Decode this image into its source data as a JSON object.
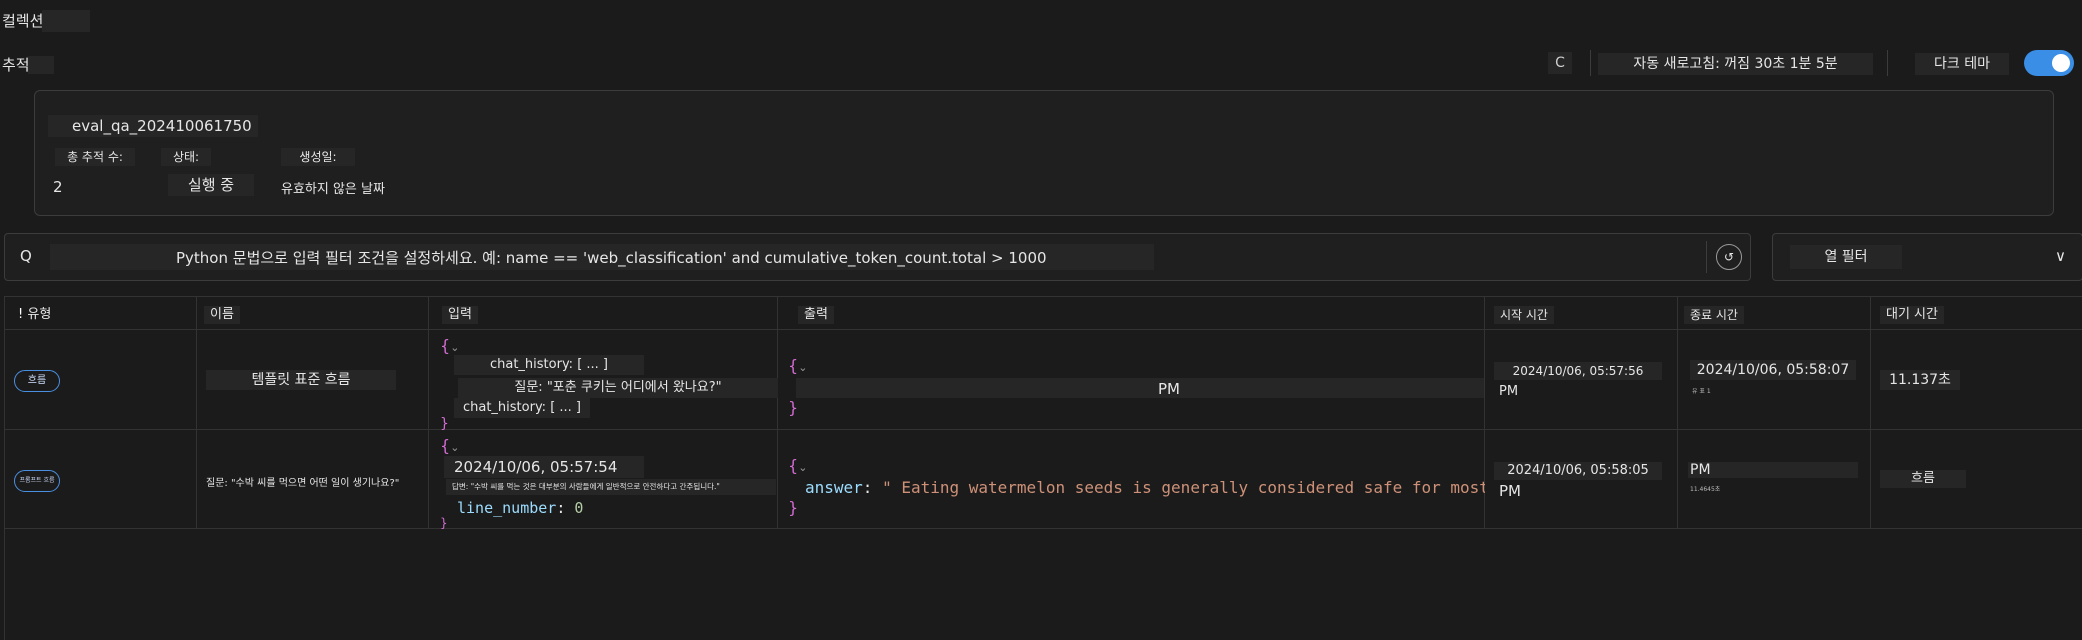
{
  "header": {
    "title": "컬렉션",
    "subnav": "추적"
  },
  "toolbar": {
    "refresh_label": "C",
    "auto_refresh": "자동 새로고침: 꺼짐 30초 1분 5분",
    "dark_mode_label": "다크 테마",
    "dark_mode_on": true
  },
  "run": {
    "name": "eval_qa_202410061750",
    "count_label": "총 추적 수:",
    "count_value": "2",
    "status_label": "상태:",
    "status_value": "실행 중",
    "created_label": "생성일:",
    "created_value": "유효하지 않은 날짜"
  },
  "search": {
    "icon": "Q",
    "placeholder": "Python 문법으로 입력 필터 조건을 설정하세요. 예: name == 'web_classification' and cumulative_token_count.total > 1000",
    "action_icon": "refresh-icon"
  },
  "column_filter": {
    "label": "열 필터",
    "chevron": "∨"
  },
  "table": {
    "headers": [
      "유형",
      "이름",
      "입력",
      "출력",
      "시작 시간",
      "종료 시간",
      "대기 시간"
    ],
    "rows": [
      {
        "type": "흐름",
        "name": "템플릿 표준 흐름",
        "input_lines": [
          "chat_history: [ ... ]",
          "질문: \"포춘 쿠키는 어디에서 왔나요?\"",
          "chat_history: [ ... ]"
        ],
        "output_tail": "PM",
        "start": "2024/10/06, 05:57:56",
        "start_suffix": "PM",
        "end": "2024/10/06, 05:58:07",
        "end_small": "유 표 1",
        "latency": "11.137초"
      },
      {
        "type": "프롬프트 흐름",
        "name": "질문: \"수박 씨를 먹으면 어떤 일이 생기나요?\"",
        "input_date": "2024/10/06, 05:57:54",
        "input_answer": "답변: \"수박 씨를 먹는 것은 대부분의 사람들에게 일반적으로 안전하다고 간주됩니다.\"",
        "input_key": "line_number",
        "input_val": "0",
        "output_key": "answer",
        "output_val": "\" Eating watermelon seeds is generally considered safe for most",
        "start": "2024/10/06, 05:58:05",
        "start_suffix": "PM",
        "end": "PM",
        "end_small": "11.4645초",
        "latency": "흐름"
      }
    ]
  },
  "colors": {
    "background": "#1b1b1b",
    "accent": "#3a8ee6",
    "json_key": "#9cdcfe",
    "json_string": "#ce9178",
    "brace": "#d16bd1"
  }
}
